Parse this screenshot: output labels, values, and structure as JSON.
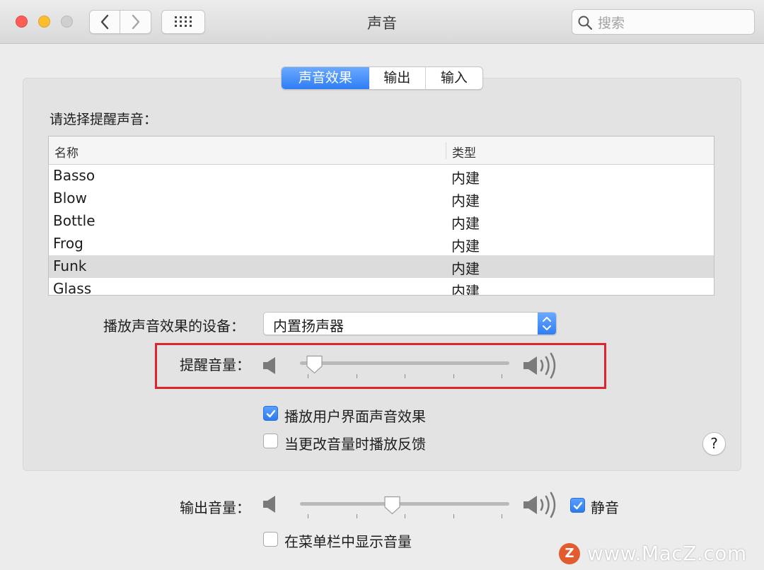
{
  "window": {
    "title": "声音"
  },
  "search": {
    "placeholder": "搜索"
  },
  "tabs": [
    {
      "label": "声音效果",
      "selected": true
    },
    {
      "label": "输出",
      "selected": false
    },
    {
      "label": "输入",
      "selected": false
    }
  ],
  "alert": {
    "label": "请选择提醒声音：",
    "columns": {
      "name": "名称",
      "type": "类型"
    },
    "sounds": [
      {
        "name": "Basso",
        "type": "内建"
      },
      {
        "name": "Blow",
        "type": "内建"
      },
      {
        "name": "Bottle",
        "type": "内建"
      },
      {
        "name": "Frog",
        "type": "内建"
      },
      {
        "name": "Funk",
        "type": "内建"
      },
      {
        "name": "Glass",
        "type": "内建"
      }
    ],
    "selected_sound": "Funk"
  },
  "device": {
    "label": "播放声音效果的设备：",
    "value": "内置扬声器"
  },
  "alert_volume": {
    "label": "提醒音量：",
    "level": 0.03
  },
  "options": {
    "ui_sound": {
      "label": "播放用户界面声音效果",
      "checked": true
    },
    "feedback": {
      "label": "当更改音量时播放反馈",
      "checked": false
    }
  },
  "output_volume": {
    "label": "输出音量：",
    "level": 0.4,
    "mute_label": "静音",
    "muted": true
  },
  "menubar_volume": {
    "label": "在菜单栏中显示音量",
    "checked": false
  },
  "help": {
    "label": "?"
  },
  "watermark": {
    "logo": "Z",
    "text": "www.MacZ.com"
  },
  "colors": {
    "accent": "#2f7ef5",
    "highlight": "#e0242b"
  }
}
